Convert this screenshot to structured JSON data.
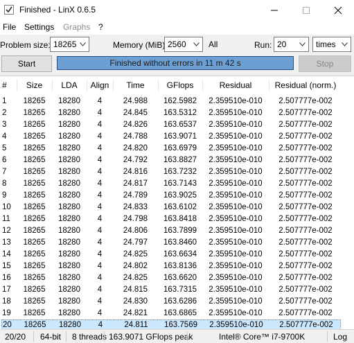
{
  "window": {
    "title": "Finished - LinX 0.6.5",
    "app_icon": "checkmark-icon",
    "controls": [
      "minimize-icon",
      "maximize-icon",
      "close-icon"
    ]
  },
  "menu": {
    "file": "File",
    "settings": "Settings",
    "graphs": "Graphs",
    "help": "?"
  },
  "toolbar": {
    "problem_size_label": "Problem size:",
    "problem_size_value": "18265",
    "memory_label": "Memory (MiB):",
    "memory_value": "2560",
    "all_label": "All",
    "run_label": "Run:",
    "run_value": "20",
    "run_unit": "times",
    "start_label": "Start",
    "stop_label": "Stop",
    "progress_text": "Finished without errors in 11 m 42 s",
    "progress_fraction": 1.0
  },
  "table": {
    "columns": [
      "#",
      "Size",
      "LDA",
      "Align",
      "Time",
      "GFlops",
      "Residual",
      "Residual (norm.)"
    ],
    "selected_row": 20,
    "rows": [
      [
        "1",
        "18265",
        "18280",
        "4",
        "24.988",
        "162.5982",
        "2.359510e-010",
        "2.507777e-002"
      ],
      [
        "2",
        "18265",
        "18280",
        "4",
        "24.845",
        "163.5312",
        "2.359510e-010",
        "2.507777e-002"
      ],
      [
        "3",
        "18265",
        "18280",
        "4",
        "24.826",
        "163.6537",
        "2.359510e-010",
        "2.507777e-002"
      ],
      [
        "4",
        "18265",
        "18280",
        "4",
        "24.788",
        "163.9071",
        "2.359510e-010",
        "2.507777e-002"
      ],
      [
        "5",
        "18265",
        "18280",
        "4",
        "24.820",
        "163.6979",
        "2.359510e-010",
        "2.507777e-002"
      ],
      [
        "6",
        "18265",
        "18280",
        "4",
        "24.792",
        "163.8827",
        "2.359510e-010",
        "2.507777e-002"
      ],
      [
        "7",
        "18265",
        "18280",
        "4",
        "24.816",
        "163.7232",
        "2.359510e-010",
        "2.507777e-002"
      ],
      [
        "8",
        "18265",
        "18280",
        "4",
        "24.817",
        "163.7143",
        "2.359510e-010",
        "2.507777e-002"
      ],
      [
        "9",
        "18265",
        "18280",
        "4",
        "24.789",
        "163.9025",
        "2.359510e-010",
        "2.507777e-002"
      ],
      [
        "10",
        "18265",
        "18280",
        "4",
        "24.833",
        "163.6102",
        "2.359510e-010",
        "2.507777e-002"
      ],
      [
        "11",
        "18265",
        "18280",
        "4",
        "24.798",
        "163.8418",
        "2.359510e-010",
        "2.507777e-002"
      ],
      [
        "12",
        "18265",
        "18280",
        "4",
        "24.806",
        "163.7899",
        "2.359510e-010",
        "2.507777e-002"
      ],
      [
        "13",
        "18265",
        "18280",
        "4",
        "24.797",
        "163.8460",
        "2.359510e-010",
        "2.507777e-002"
      ],
      [
        "14",
        "18265",
        "18280",
        "4",
        "24.825",
        "163.6634",
        "2.359510e-010",
        "2.507777e-002"
      ],
      [
        "15",
        "18265",
        "18280",
        "4",
        "24.802",
        "163.8136",
        "2.359510e-010",
        "2.507777e-002"
      ],
      [
        "16",
        "18265",
        "18280",
        "4",
        "24.825",
        "163.6620",
        "2.359510e-010",
        "2.507777e-002"
      ],
      [
        "17",
        "18265",
        "18280",
        "4",
        "24.815",
        "163.7315",
        "2.359510e-010",
        "2.507777e-002"
      ],
      [
        "18",
        "18265",
        "18280",
        "4",
        "24.830",
        "163.6286",
        "2.359510e-010",
        "2.507777e-002"
      ],
      [
        "19",
        "18265",
        "18280",
        "4",
        "24.821",
        "163.6865",
        "2.359510e-010",
        "2.507777e-002"
      ],
      [
        "20",
        "18265",
        "18280",
        "4",
        "24.811",
        "163.7569",
        "2.359510e-010",
        "2.507777e-002"
      ]
    ]
  },
  "status": {
    "progress": "20/20",
    "bits": "64-bit",
    "threads": "8 threads",
    "peak": "163.9071 GFlops peak",
    "cpu": "Intel® Core™ i7-9700K",
    "log": "Log"
  },
  "colors": {
    "progress_fill": "#6d9fd3",
    "selection": "#cce8ff"
  }
}
